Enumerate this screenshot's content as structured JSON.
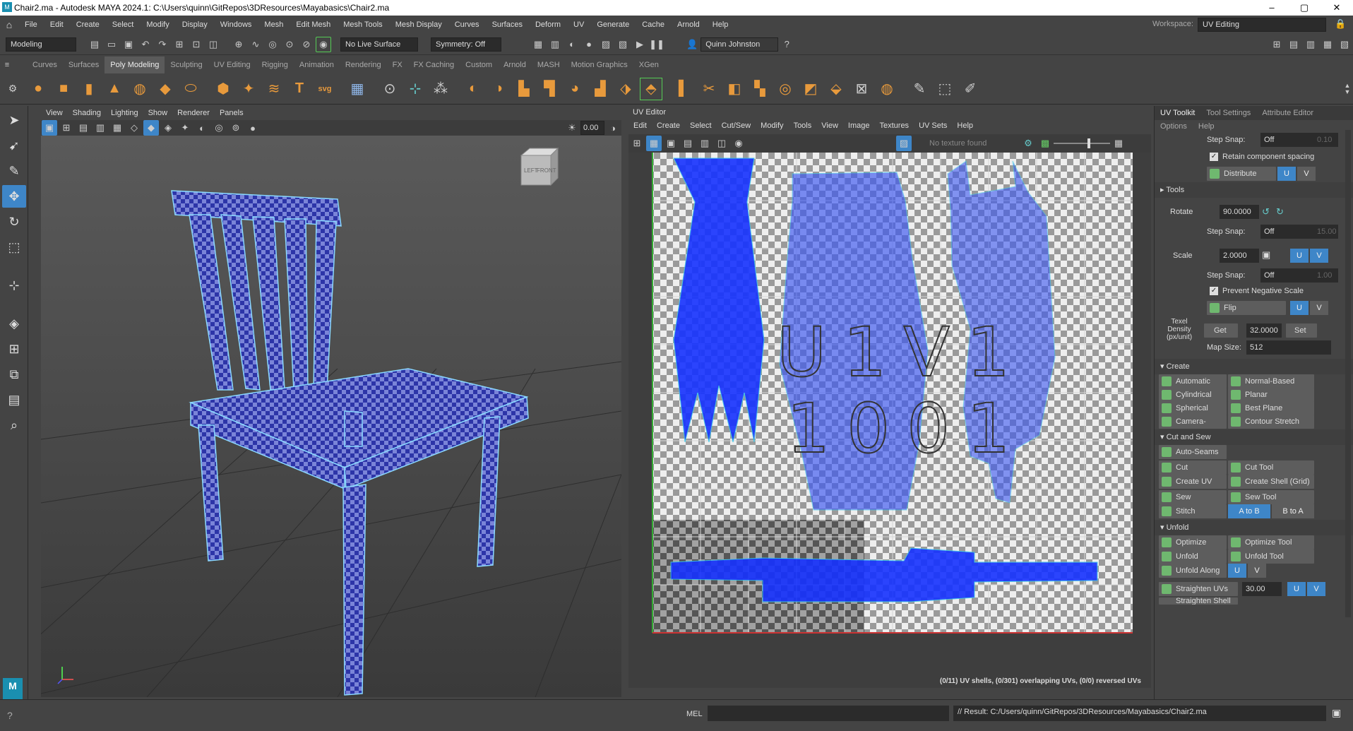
{
  "window": {
    "title": "Chair2.ma - Autodesk MAYA 2024.1: C:\\Users\\quinn\\GitRepos\\3DResources\\Mayabasics\\Chair2.ma",
    "minimize": "–",
    "maximize": "▢",
    "close": "✕"
  },
  "menubar": {
    "items": [
      "File",
      "Edit",
      "Create",
      "Select",
      "Modify",
      "Display",
      "Windows",
      "Mesh",
      "Edit Mesh",
      "Mesh Tools",
      "Mesh Display",
      "Curves",
      "Surfaces",
      "Deform",
      "UV",
      "Generate",
      "Cache",
      "Arnold",
      "Help"
    ],
    "workspace_label": "Workspace:",
    "workspace_value": "UV Editing"
  },
  "statusline": {
    "mode": "Modeling",
    "live_surface": "No Live Surface",
    "symmetry": "Symmetry: Off",
    "user": "Quinn Johnston"
  },
  "shelf": {
    "tabs": [
      "Curves",
      "Surfaces",
      "Poly Modeling",
      "Sculpting",
      "UV Editing",
      "Rigging",
      "Animation",
      "Rendering",
      "FX",
      "FX Caching",
      "Custom",
      "Arnold",
      "MASH",
      "Motion Graphics",
      "XGen"
    ],
    "active": "Poly Modeling"
  },
  "viewport": {
    "menu": [
      "View",
      "Shading",
      "Lighting",
      "Show",
      "Renderer",
      "Panels"
    ],
    "value": "0.00",
    "cube_left": "LEFT",
    "cube_front": "FRONT"
  },
  "uv_editor": {
    "title": "UV Editor",
    "menu": [
      "Edit",
      "Create",
      "Select",
      "Cut/Sew",
      "Modify",
      "Tools",
      "View",
      "Image",
      "Textures",
      "UV Sets",
      "Help"
    ],
    "texture": "No texture found",
    "udim_line1": "U1V1",
    "udim_line2": "1001",
    "info": "(0/11) UV shells, (0/301) overlapping UVs, (0/0) reversed UVs"
  },
  "toolkit": {
    "tabs": [
      "UV Toolkit",
      "Tool Settings",
      "Attribute Editor"
    ],
    "submenu": [
      "Options",
      "Help"
    ],
    "step_snap_label": "Step Snap:",
    "step_snap_value": "Off",
    "step_snap_num1": "0.10",
    "retain_label": "Retain component spacing",
    "distribute": "Distribute",
    "u": "U",
    "v": "V",
    "tools_section": "Tools",
    "rotate_label": "Rotate",
    "rotate_value": "90.0000",
    "step_snap_num2": "15.00",
    "scale_label": "Scale",
    "scale_value": "2.0000",
    "step_snap_num3": "1.00",
    "prevent_label": "Prevent Negative Scale",
    "flip": "Flip",
    "texel_label": "Texel Density (px/unit)",
    "get": "Get",
    "texel_value": "32.0000",
    "set": "Set",
    "map_size_label": "Map Size:",
    "map_size_value": "512",
    "create_section": "Create",
    "create_buttons": [
      "Automatic",
      "Normal-Based",
      "Cylindrical",
      "Planar",
      "Spherical",
      "Best Plane",
      "Camera-Based",
      "Contour Stretch"
    ],
    "cut_section": "Cut and Sew",
    "auto_seams": "Auto-Seams",
    "cut": "Cut",
    "cut_tool": "Cut Tool",
    "create_uv_shell": "Create UV Shell",
    "create_shell_grid": "Create Shell (Grid)",
    "sew": "Sew",
    "sew_tool": "Sew Tool",
    "stitch": "Stitch Together",
    "a_to_b": "A to B",
    "b_to_a": "B to A",
    "unfold_section": "Unfold",
    "optimize": "Optimize",
    "optimize_tool": "Optimize Tool",
    "unfold": "Unfold",
    "unfold_tool": "Unfold Tool",
    "unfold_along": "Unfold Along",
    "straighten": "Straighten UVs",
    "straighten_value": "30.00",
    "straighten_shell": "Straighten Shell"
  },
  "bottom": {
    "mel": "MEL",
    "result": "// Result: C:/Users/quinn/GitRepos/3DResources/Mayabasics/Chair2.ma",
    "maya_badge": "M"
  }
}
